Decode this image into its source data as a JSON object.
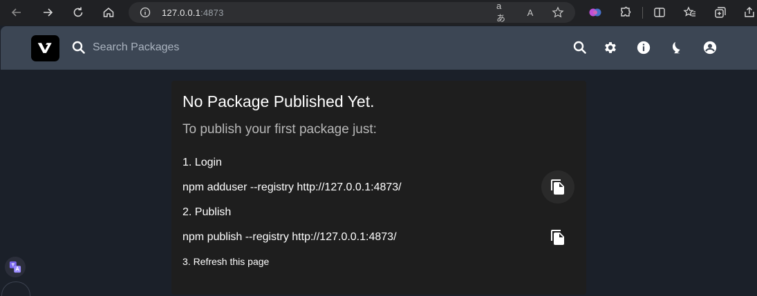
{
  "browser": {
    "url_host": "127.0.0.1",
    "url_port": ":4873",
    "read_aloud_label": "A",
    "translate_label": "aあ"
  },
  "header": {
    "logo_letter": "V",
    "search_placeholder": "Search Packages"
  },
  "card": {
    "title": "No Package Published Yet.",
    "subtitle": "To publish your first package just:",
    "step1": "1. Login",
    "cmd1": "npm adduser --registry http://127.0.0.1:4873/",
    "step2": "2. Publish",
    "cmd2": "npm publish --registry http://127.0.0.1:4873/",
    "step3": "3. Refresh this page"
  },
  "colors": {
    "page_bg": "#1b2029",
    "header_bg": "#3c4654",
    "card_bg": "#1e1e1e",
    "browser_bg": "#202124"
  }
}
